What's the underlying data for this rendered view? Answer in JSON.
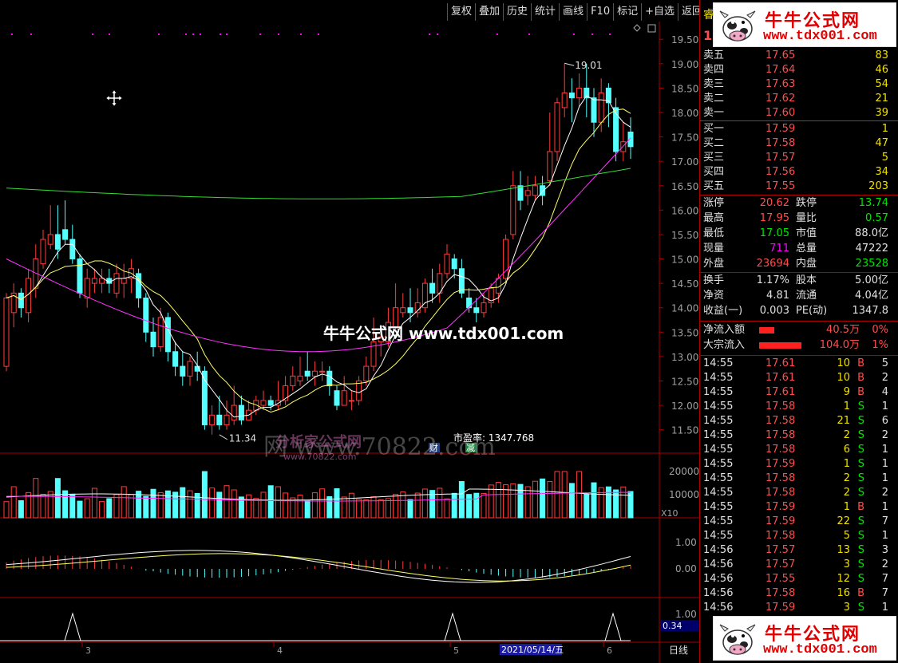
{
  "toolbar": {
    "items": [
      "复权",
      "叠加",
      "历史",
      "统计",
      "画线",
      "F10",
      "标记",
      "+自选",
      "返回"
    ]
  },
  "panel": {
    "title_partial": "睿",
    "price_partial": "17",
    "sell": [
      {
        "label": "卖五",
        "price": "17.65",
        "vol": "83"
      },
      {
        "label": "卖四",
        "price": "17.64",
        "vol": "46"
      },
      {
        "label": "卖三",
        "price": "17.63",
        "vol": "54"
      },
      {
        "label": "卖二",
        "price": "17.62",
        "vol": "21"
      },
      {
        "label": "卖一",
        "price": "17.60",
        "vol": "39"
      }
    ],
    "buy": [
      {
        "label": "买一",
        "price": "17.59",
        "vol": "1"
      },
      {
        "label": "买二",
        "price": "17.58",
        "vol": "47"
      },
      {
        "label": "买三",
        "price": "17.57",
        "vol": "5"
      },
      {
        "label": "买四",
        "price": "17.56",
        "vol": "34"
      },
      {
        "label": "买五",
        "price": "17.55",
        "vol": "203"
      }
    ],
    "stats": [
      {
        "l1": "涨停",
        "v1": "20.62",
        "c1": "red",
        "l2": "跌停",
        "v2": "13.74",
        "c2": "green"
      },
      {
        "l1": "最高",
        "v1": "17.95",
        "c1": "red",
        "l2": "量比",
        "v2": "0.57",
        "c2": "green"
      },
      {
        "l1": "最低",
        "v1": "17.05",
        "c1": "green",
        "l2": "市值",
        "v2": "88.0亿",
        "c2": "white"
      },
      {
        "l1": "现量",
        "v1": "711",
        "c1": "magenta",
        "l2": "总量",
        "v2": "47222",
        "c2": "white"
      },
      {
        "l1": "外盘",
        "v1": "23694",
        "c1": "red",
        "l2": "内盘",
        "v2": "23528",
        "c2": "green"
      }
    ],
    "stats2": [
      {
        "l1": "换手",
        "v1": "1.17%",
        "l2": "股本",
        "v2": "5.00亿"
      },
      {
        "l1": "净资",
        "v1": "4.81",
        "l2": "流通",
        "v2": "4.04亿"
      },
      {
        "l1": "收益(一)",
        "v1": "0.003",
        "l2": "PE(动)",
        "v2": "1347.8"
      }
    ],
    "flows": [
      {
        "label": "净流入额",
        "value": "40.5万",
        "pct": "0%",
        "bar": 0.3
      },
      {
        "label": "大宗流入",
        "value": "104.0万",
        "pct": "1%",
        "bar": 0.85
      }
    ],
    "ticks": [
      {
        "t": "14:55",
        "p": "17.61",
        "v": "10",
        "d": "B",
        "n": "5"
      },
      {
        "t": "14:55",
        "p": "17.61",
        "v": "10",
        "d": "B",
        "n": "2"
      },
      {
        "t": "14:55",
        "p": "17.61",
        "v": "9",
        "d": "B",
        "n": "4"
      },
      {
        "t": "14:55",
        "p": "17.58",
        "v": "1",
        "d": "S",
        "n": "1"
      },
      {
        "t": "14:55",
        "p": "17.58",
        "v": "21",
        "d": "S",
        "n": "6"
      },
      {
        "t": "14:55",
        "p": "17.58",
        "v": "2",
        "d": "S",
        "n": "2"
      },
      {
        "t": "14:55",
        "p": "17.58",
        "v": "6",
        "d": "S",
        "n": "1"
      },
      {
        "t": "14:55",
        "p": "17.59",
        "v": "1",
        "d": "S",
        "n": "1"
      },
      {
        "t": "14:55",
        "p": "17.58",
        "v": "2",
        "d": "S",
        "n": "1"
      },
      {
        "t": "14:55",
        "p": "17.58",
        "v": "2",
        "d": "S",
        "n": "2"
      },
      {
        "t": "14:55",
        "p": "17.59",
        "v": "1",
        "d": "B",
        "n": "1"
      },
      {
        "t": "14:55",
        "p": "17.59",
        "v": "22",
        "d": "S",
        "n": "7"
      },
      {
        "t": "14:55",
        "p": "17.58",
        "v": "5",
        "d": "S",
        "n": "1"
      },
      {
        "t": "14:56",
        "p": "17.57",
        "v": "13",
        "d": "S",
        "n": "3"
      },
      {
        "t": "14:56",
        "p": "17.57",
        "v": "3",
        "d": "S",
        "n": "2"
      },
      {
        "t": "14:56",
        "p": "17.55",
        "v": "12",
        "d": "S",
        "n": "7"
      },
      {
        "t": "14:56",
        "p": "17.58",
        "v": "16",
        "d": "B",
        "n": "7"
      },
      {
        "t": "14:56",
        "p": "17.59",
        "v": "3",
        "d": "S",
        "n": "1"
      }
    ]
  },
  "chart": {
    "price_axis": [
      "19.50",
      "19.00",
      "18.50",
      "18.00",
      "17.50",
      "17.00",
      "16.50",
      "16.00",
      "15.50",
      "15.00",
      "14.50",
      "14.00",
      "13.50",
      "13.00",
      "12.50",
      "12.00",
      "11.50"
    ],
    "high_label": "19.01",
    "low_label": "11.34",
    "pe_label": "市盈率: 1347.768",
    "vol_axis": [
      "20000",
      "10000"
    ],
    "vol_unit": "X10",
    "macd_axis": [
      "1.00",
      "0.00"
    ],
    "ind_axis": [
      "1.00"
    ],
    "ind_value": "0.34",
    "date_labels": [
      "3",
      "4",
      "5",
      "6"
    ],
    "date_selected": "2021/05/14/五",
    "period": "日线",
    "tag_cai": "财",
    "tag_jian": "减"
  },
  "watermarks": {
    "brand": "牛牛公式网",
    "url": "www.tdx001.com",
    "center": "牛牛公式网 www.tdx001.com",
    "faint": "网 www.70822.com",
    "faint_brand": "分析家公式网",
    "faint_url": "www.70822.com"
  },
  "chart_data": {
    "type": "candlestick",
    "title": "",
    "ylim": [
      11.2,
      19.7
    ],
    "candles": [
      [
        12.8,
        14.2,
        14.3,
        12.7
      ],
      [
        13.9,
        14.3,
        14.5,
        13.6
      ],
      [
        14.3,
        14.0,
        14.4,
        13.8
      ],
      [
        13.9,
        14.6,
        14.8,
        13.7
      ],
      [
        14.4,
        15.0,
        15.3,
        14.2
      ],
      [
        14.9,
        15.4,
        15.6,
        14.8
      ],
      [
        15.3,
        15.5,
        16.1,
        15.2
      ],
      [
        15.5,
        15.2,
        16.1,
        15.0
      ],
      [
        15.6,
        15.4,
        16.2,
        15.3
      ],
      [
        15.4,
        15.0,
        15.7,
        14.9
      ],
      [
        15.0,
        14.3,
        15.1,
        14.2
      ],
      [
        14.2,
        14.6,
        14.8,
        14.0
      ],
      [
        14.5,
        14.6,
        14.8,
        14.3
      ],
      [
        14.5,
        14.6,
        14.8,
        14.3
      ],
      [
        14.6,
        14.5,
        14.8,
        14.3
      ],
      [
        14.3,
        14.7,
        14.9,
        14.2
      ],
      [
        14.5,
        14.6,
        14.9,
        14.2
      ],
      [
        14.6,
        14.8,
        15.0,
        14.3
      ],
      [
        14.7,
        14.2,
        14.8,
        14.0
      ],
      [
        14.2,
        13.5,
        14.3,
        13.3
      ],
      [
        13.5,
        13.2,
        13.8,
        13.0
      ],
      [
        13.2,
        13.8,
        14.0,
        13.1
      ],
      [
        13.8,
        13.1,
        13.9,
        12.9
      ],
      [
        13.1,
        12.8,
        13.3,
        12.6
      ],
      [
        12.8,
        12.6,
        13.1,
        12.4
      ],
      [
        12.6,
        12.9,
        13.0,
        12.4
      ],
      [
        12.8,
        12.7,
        13.1,
        12.5
      ],
      [
        12.7,
        11.6,
        12.8,
        11.5
      ],
      [
        11.6,
        11.8,
        12.0,
        11.4
      ],
      [
        11.8,
        11.6,
        12.2,
        11.5
      ],
      [
        11.6,
        11.8,
        12.1,
        11.5
      ],
      [
        11.7,
        12.0,
        12.4,
        11.6
      ],
      [
        12.0,
        11.7,
        12.2,
        11.6
      ],
      [
        11.7,
        11.9,
        12.1,
        11.7
      ],
      [
        11.9,
        12.1,
        12.2,
        11.8
      ],
      [
        12.0,
        12.1,
        12.3,
        11.9
      ],
      [
        12.1,
        12.0,
        12.2,
        11.9
      ],
      [
        12.0,
        12.1,
        12.5,
        11.9
      ],
      [
        12.1,
        12.4,
        12.6,
        12.0
      ],
      [
        12.4,
        12.6,
        12.8,
        12.3
      ],
      [
        12.5,
        12.6,
        13.0,
        12.4
      ],
      [
        12.7,
        12.6,
        13.1,
        12.5
      ],
      [
        12.6,
        12.7,
        12.9,
        12.4
      ],
      [
        12.7,
        12.7,
        12.9,
        12.5
      ],
      [
        12.7,
        12.4,
        12.8,
        12.2
      ],
      [
        12.3,
        12.0,
        12.4,
        11.9
      ],
      [
        12.0,
        12.3,
        12.6,
        12.0
      ],
      [
        12.1,
        12.1,
        12.3,
        11.9
      ],
      [
        12.1,
        12.5,
        12.6,
        12.0
      ],
      [
        12.5,
        12.8,
        13.0,
        12.4
      ],
      [
        12.8,
        13.3,
        13.8,
        12.7
      ],
      [
        13.3,
        13.4,
        13.6,
        13.0
      ],
      [
        13.3,
        13.7,
        14.0,
        13.2
      ],
      [
        13.6,
        14.0,
        14.5,
        13.5
      ],
      [
        13.9,
        14.0,
        14.3,
        13.8
      ],
      [
        14.0,
        13.9,
        14.4,
        13.7
      ],
      [
        13.9,
        14.1,
        14.4,
        13.8
      ],
      [
        14.0,
        14.5,
        14.6,
        13.9
      ],
      [
        14.5,
        14.3,
        14.8,
        14.1
      ],
      [
        14.3,
        14.7,
        14.9,
        14.1
      ],
      [
        14.7,
        15.1,
        15.3,
        14.6
      ],
      [
        15.0,
        14.8,
        15.1,
        14.6
      ],
      [
        14.8,
        14.3,
        15.0,
        14.2
      ],
      [
        14.2,
        14.0,
        14.4,
        13.9
      ],
      [
        14.0,
        13.9,
        14.2,
        13.7
      ],
      [
        13.9,
        14.1,
        14.3,
        13.8
      ],
      [
        14.1,
        14.4,
        14.5,
        14.0
      ],
      [
        14.3,
        14.6,
        14.7,
        14.1
      ],
      [
        14.6,
        15.4,
        15.5,
        14.5
      ],
      [
        15.5,
        16.5,
        16.8,
        15.4
      ],
      [
        16.5,
        16.2,
        16.8,
        16.0
      ],
      [
        16.3,
        16.4,
        16.7,
        16.1
      ],
      [
        16.3,
        16.5,
        16.7,
        16.2
      ],
      [
        16.5,
        16.3,
        16.7,
        16.1
      ],
      [
        16.6,
        17.2,
        18.0,
        16.5
      ],
      [
        17.2,
        18.2,
        18.3,
        17.0
      ],
      [
        18.1,
        18.4,
        19.0,
        17.9
      ],
      [
        18.4,
        18.3,
        18.7,
        17.8
      ],
      [
        18.3,
        18.5,
        18.8,
        18.1
      ],
      [
        18.5,
        18.3,
        19.0,
        17.9
      ],
      [
        18.3,
        17.8,
        18.5,
        17.5
      ],
      [
        17.8,
        18.4,
        18.7,
        17.6
      ],
      [
        18.5,
        18.2,
        18.6,
        17.7
      ],
      [
        18.1,
        17.2,
        18.3,
        17.0
      ],
      [
        17.2,
        17.4,
        17.8,
        17.0
      ],
      [
        17.6,
        17.3,
        17.9,
        17.05
      ]
    ]
  }
}
